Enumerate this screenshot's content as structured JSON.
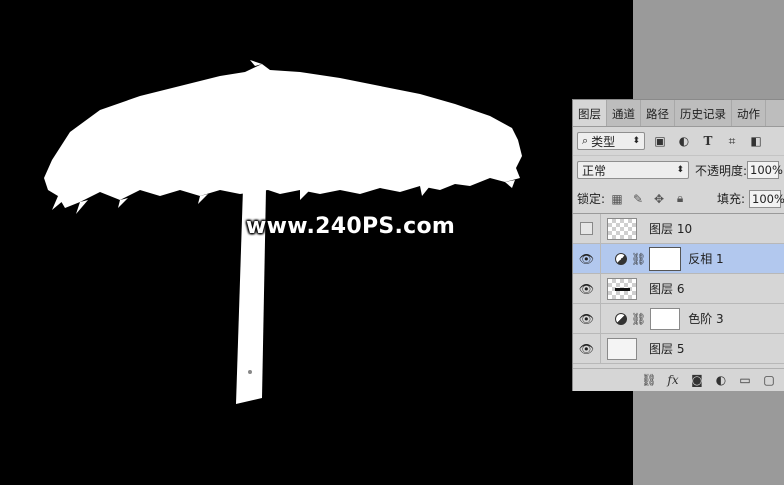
{
  "watermark": "www.240PS.com",
  "panel": {
    "tabs": [
      "图层",
      "通道",
      "路径",
      "历史记录",
      "动作"
    ],
    "filter": {
      "label": "类型",
      "icons": [
        "image-filter-icon",
        "adjust-filter-icon",
        "text-filter-icon",
        "shape-filter-icon",
        "smart-filter-icon"
      ]
    },
    "blend_mode": "正常",
    "opacity_label": "不透明度:",
    "opacity_value": "100%",
    "lock_label": "锁定:",
    "fill_label": "填充:",
    "fill_value": "100%",
    "layers": [
      {
        "name": "图层 10",
        "visible": false,
        "type": "pixel",
        "selected": false
      },
      {
        "name": "反相 1",
        "visible": true,
        "type": "adjustment",
        "selected": true
      },
      {
        "name": "图层 6",
        "visible": true,
        "type": "pixel",
        "selected": false
      },
      {
        "name": "色阶 3",
        "visible": true,
        "type": "adjustment",
        "selected": false
      },
      {
        "name": "图层 5",
        "visible": true,
        "type": "pixel",
        "selected": false
      }
    ]
  }
}
